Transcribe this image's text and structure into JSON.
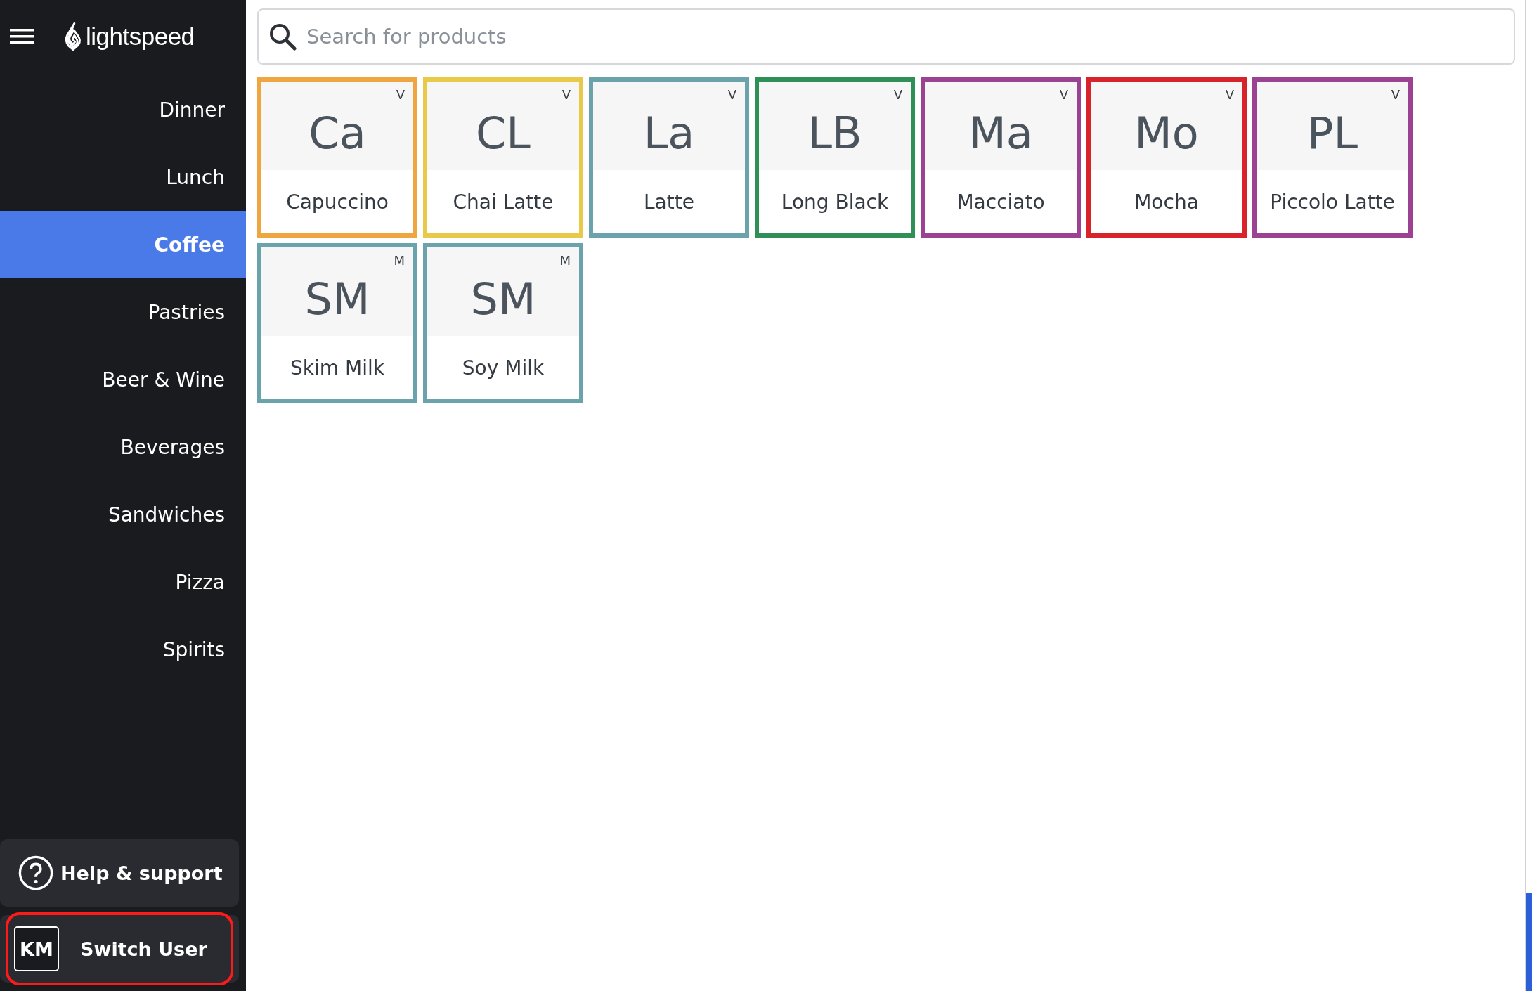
{
  "brand": {
    "name": "lightspeed"
  },
  "sidebar": {
    "items": [
      {
        "label": "Dinner",
        "selected": false
      },
      {
        "label": "Lunch",
        "selected": false
      },
      {
        "label": "Coffee",
        "selected": true
      },
      {
        "label": "Pastries",
        "selected": false
      },
      {
        "label": "Beer & Wine",
        "selected": false
      },
      {
        "label": "Beverages",
        "selected": false
      },
      {
        "label": "Sandwiches",
        "selected": false
      },
      {
        "label": "Pizza",
        "selected": false
      },
      {
        "label": "Spirits",
        "selected": false
      }
    ],
    "help": {
      "label": "Help & support"
    },
    "switch_user": {
      "initials": "KM",
      "label": "Switch User",
      "highlighted": true
    }
  },
  "search": {
    "placeholder": "Search for products"
  },
  "products": [
    {
      "abbr": "Ca",
      "name": "Capuccino",
      "tag": "V",
      "color": "#f0a640"
    },
    {
      "abbr": "CL",
      "name": "Chai Latte",
      "tag": "V",
      "color": "#e8c948"
    },
    {
      "abbr": "La",
      "name": "Latte",
      "tag": "V",
      "color": "#6ba3ad"
    },
    {
      "abbr": "LB",
      "name": "Long Black",
      "tag": "V",
      "color": "#2e8f57"
    },
    {
      "abbr": "Ma",
      "name": "Macciato",
      "tag": "V",
      "color": "#9b4293"
    },
    {
      "abbr": "Mo",
      "name": "Mocha",
      "tag": "V",
      "color": "#d8232a"
    },
    {
      "abbr": "PL",
      "name": "Piccolo Latte",
      "tag": "V",
      "color": "#9b4293"
    },
    {
      "abbr": "SM",
      "name": "Skim Milk",
      "tag": "M",
      "color": "#6ba3ad"
    },
    {
      "abbr": "SM",
      "name": "Soy Milk",
      "tag": "M",
      "color": "#6ba3ad"
    }
  ]
}
